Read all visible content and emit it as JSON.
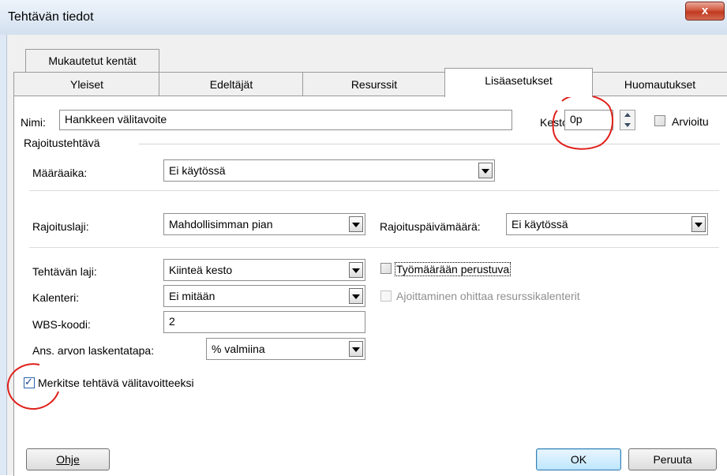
{
  "window": {
    "title": "Tehtävän tiedot",
    "close_glyph": "x"
  },
  "tabs": {
    "row1": [
      {
        "label": "Mukautetut kentät"
      }
    ],
    "row2": [
      {
        "label": "Yleiset"
      },
      {
        "label": "Edeltäjät"
      },
      {
        "label": "Resurssit"
      },
      {
        "label": "Lisäasetukset",
        "active": true
      },
      {
        "label": "Huomautukset"
      }
    ]
  },
  "form": {
    "name_label": "Nimi:",
    "name_value": "Hankkeen välitavoite",
    "duration_label": "Kesto:",
    "duration_value": "0p",
    "estimated_label": "Arvioitu",
    "constraint_group_label": "Rajoitustehtävä",
    "deadline_label": "Määräaika:",
    "deadline_value": "Ei käytössä",
    "constraint_type_label": "Rajoituslaji:",
    "constraint_type_value": "Mahdollisimman pian",
    "constraint_date_label": "Rajoituspäivämäärä:",
    "constraint_date_value": "Ei käytössä",
    "task_type_label": "Tehtävän laji:",
    "task_type_value": "Kiinteä kesto",
    "effort_driven_label": "Työmäärään perustuva",
    "calendar_label": "Kalenteri:",
    "calendar_value": "Ei mitään",
    "ignore_calendars_label": "Ajoittaminen ohittaa resurssikalenterit",
    "wbs_label": "WBS-koodi:",
    "wbs_value": "2",
    "ev_method_label": "Ans. arvon laskentatapa:",
    "ev_method_value": "% valmiina",
    "milestone_label": "Merkitse tehtävä välitavoitteeksi",
    "milestone_checked": true
  },
  "buttons": {
    "help": "Ohje",
    "ok": "OK",
    "cancel": "Peruuta"
  },
  "colors": {
    "annotation": "#e0201a",
    "accent": "#3c7fb1"
  }
}
